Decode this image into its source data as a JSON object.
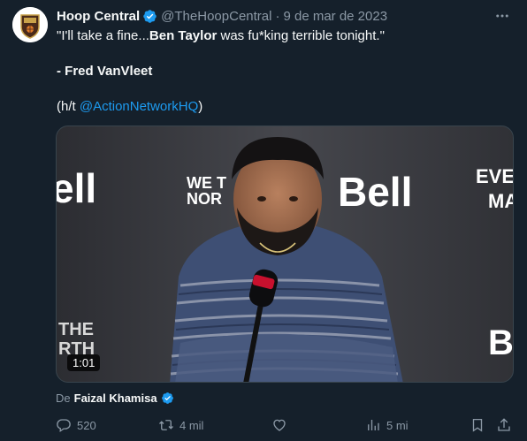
{
  "tweet": {
    "author_name": "Hoop Central",
    "author_handle": "@TheHoopCentral",
    "separator": "·",
    "date": "9 de mar de 2023",
    "line1_a": "\"I'll take a fine...",
    "line1_b": "Ben Taylor",
    "line1_c": " was fu*king terrible tonight.\"",
    "line2": "- Fred VanVleet",
    "line3_a": "(h/t ",
    "line3_link": "@ActionNetworkHQ",
    "line3_b": ")"
  },
  "media": {
    "duration": "1:01",
    "backdrop_texts": [
      "ell",
      "WE T",
      "NOR",
      "Bell",
      "EVER",
      "MA",
      "THE",
      "RTH",
      "B"
    ]
  },
  "attribution": {
    "prefix": "De",
    "name": "Faizal Khamisa"
  },
  "actions": {
    "replies": "520",
    "reposts": "4 mil",
    "likes": "",
    "views": "5 mi"
  },
  "icons": {
    "verified": "verified-badge-icon",
    "more": "more-icon",
    "reply": "reply-icon",
    "repost": "repost-icon",
    "like": "like-icon",
    "views": "views-icon",
    "bookmark": "bookmark-icon",
    "share": "share-icon"
  },
  "colors": {
    "background": "#15202b",
    "accent": "#1d9bf0",
    "muted": "#8b98a5",
    "text": "#f7f9f9"
  }
}
